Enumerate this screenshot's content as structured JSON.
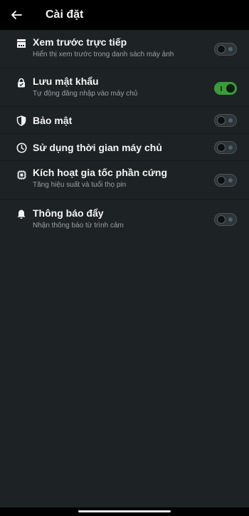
{
  "header": {
    "title": "Cài đặt",
    "back_icon": "arrow-left-icon"
  },
  "settings": [
    {
      "icon": "preview-icon",
      "title": "Xem trước trực tiếp",
      "subtitle": "Hiển thị xem trước trong danh sách máy ảnh",
      "enabled": false
    },
    {
      "icon": "lock-icon",
      "title": "Lưu mật khẩu",
      "subtitle": "Tự động đăng nhập vào máy chủ",
      "enabled": true
    },
    {
      "icon": "shield-icon",
      "title": "Bảo mật",
      "subtitle": "",
      "enabled": false
    },
    {
      "icon": "clock-icon",
      "title": "Sử dụng thời gian máy chủ",
      "subtitle": "",
      "enabled": false
    },
    {
      "icon": "chip-icon",
      "title": "Kích hoạt gia tốc phần cứng",
      "subtitle": "Tăng hiệu suất và tuổi thọ pin",
      "enabled": false
    },
    {
      "icon": "bell-icon",
      "title": "Thông báo đẩy",
      "subtitle": "Nhận thông báo từ trình cảm",
      "enabled": false
    }
  ],
  "colors": {
    "background": "#1d2224",
    "toggle_on": "#3d9b3a",
    "toggle_off": "#2f3538"
  }
}
